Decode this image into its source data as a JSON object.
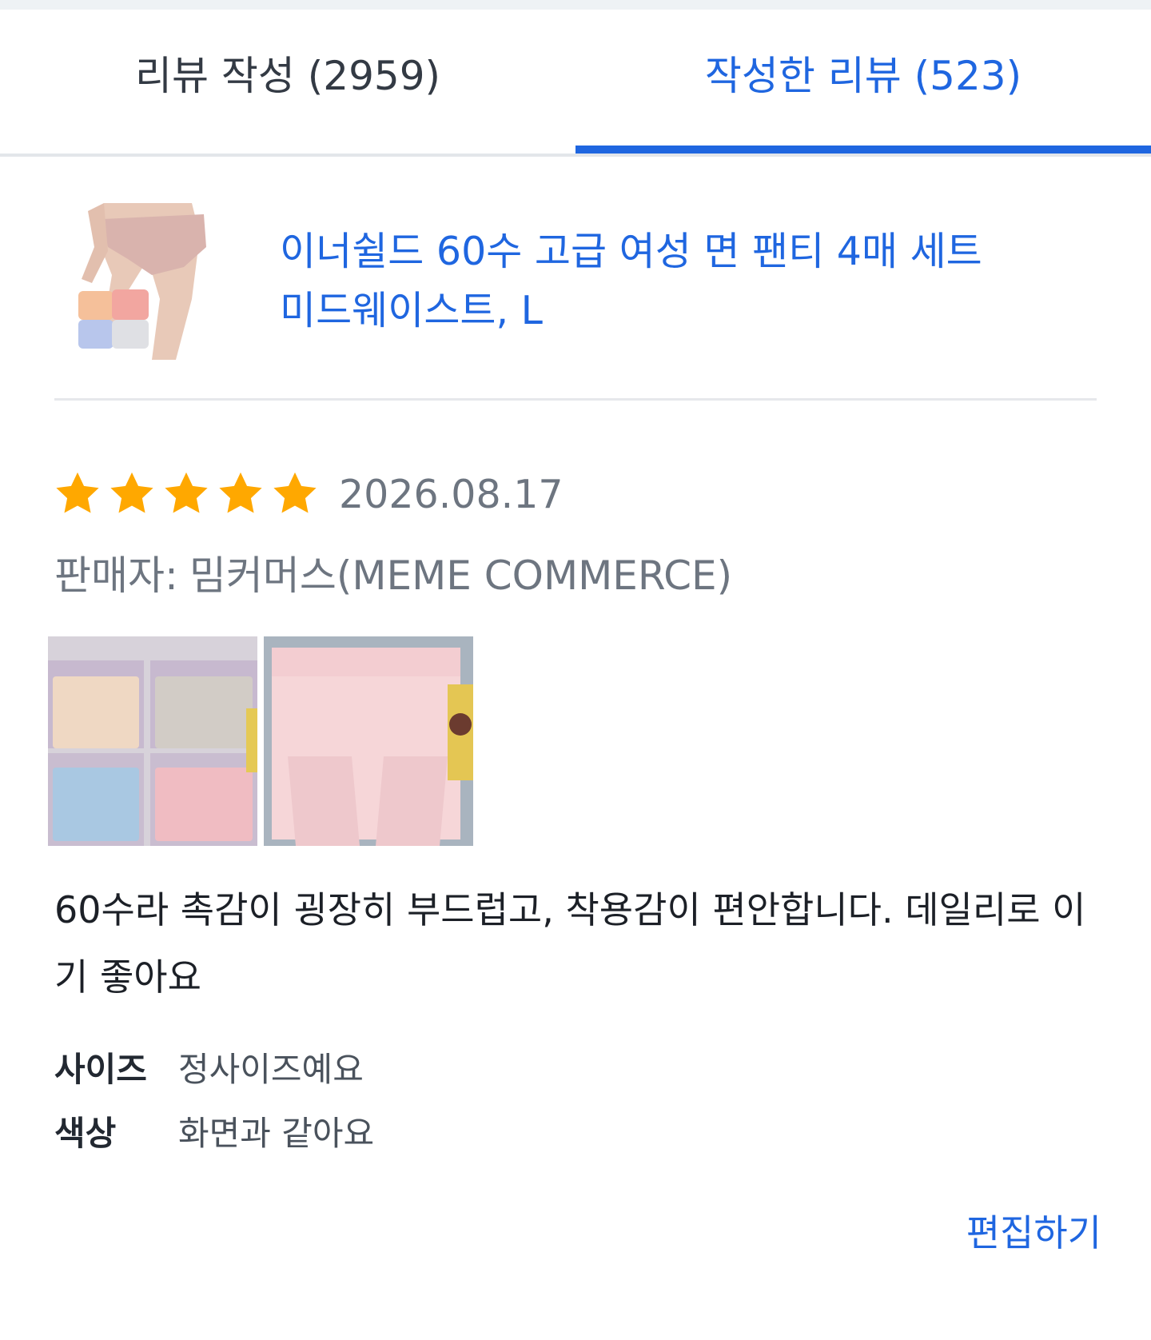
{
  "tabs": [
    {
      "label": "리뷰 작성 (2959)",
      "active": false
    },
    {
      "label": "작성한 리뷰 (523)",
      "active": true
    }
  ],
  "product": {
    "name_line1": "이너쉴드 60수 고급 여성 면 팬티 4매 세트",
    "name_line2": "미드웨이스트, L"
  },
  "review": {
    "rating": 5,
    "max_rating": 5,
    "date": "2026.08.17",
    "seller_label": "판매자:",
    "seller_name": "밈커머스(MEME COMMERCE)",
    "text": "60수라 촉감이 굉장히 부드럽고, 착용감이 편안합니다. 데일리로 이기 좋아요",
    "attributes": [
      {
        "label": "사이즈",
        "value": "정사이즈예요"
      },
      {
        "label": "색상",
        "value": "화면과 같아요"
      }
    ],
    "edit_label": "편집하기"
  },
  "colors": {
    "accent": "#1f66e0",
    "star": "#ffa800",
    "muted_text": "#6d7580"
  },
  "icons": {
    "star": "star-icon"
  }
}
